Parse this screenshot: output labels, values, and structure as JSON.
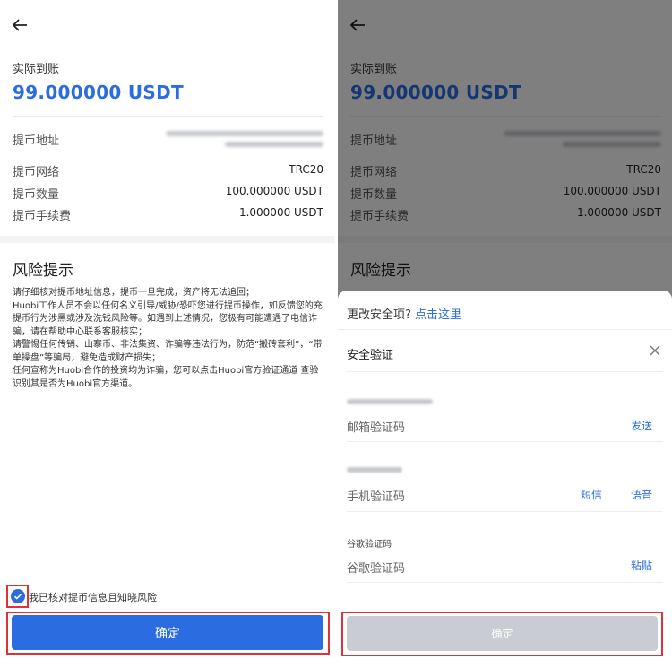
{
  "screen": {
    "actual_label": "实际到账",
    "amount": "99.000000 USDT",
    "rows": [
      {
        "label": "提币地址",
        "value": ""
      },
      {
        "label": "提币网络",
        "value": "TRC20"
      },
      {
        "label": "提币数量",
        "value": "100.000000 USDT"
      },
      {
        "label": "提币手续费",
        "value": "1.000000 USDT"
      }
    ],
    "risk_title": "风险提示",
    "risk_lines": [
      "请仔细核对提币地址信息，提币一旦完成，资产将无法追回；",
      "Huobi工作人员不会以任何名义引导/威胁/恐吓您进行提币操作，如反馈您的充提币行为涉黑或涉及洗钱风险等。如遇到上述情况，您极有可能遭遇了电信诈骗，请在帮助中心联系客服核实；",
      "请警惕任何传销、山寨币、非法集资、诈骗等违法行为，防范“搬砖套利”，“带单操盘”等骗局，避免造成财产损失；",
      "任何宣称为Huobi合作的投资均为诈骗，您可以点击Huobi官方验证通道 查验识别其是否为Huobi官方渠道。"
    ],
    "confirm_check_label": "我已核对提币信息且知晓风险",
    "confirm_button": "确定"
  },
  "sheet": {
    "change_prompt": "更改安全项?",
    "change_link": "点击这里",
    "title": "安全验证",
    "email_placeholder": "邮箱验证码",
    "email_send": "发送",
    "phone_placeholder": "手机验证码",
    "phone_sms": "短信",
    "phone_voice": "语音",
    "google_label": "谷歌验证码",
    "google_placeholder": "谷歌验证码",
    "google_paste": "粘贴",
    "confirm_button": "确定"
  },
  "colors": {
    "accent": "#2b6de0",
    "highlight": "#e0313b",
    "disabled_button": "#c9ccd2"
  }
}
